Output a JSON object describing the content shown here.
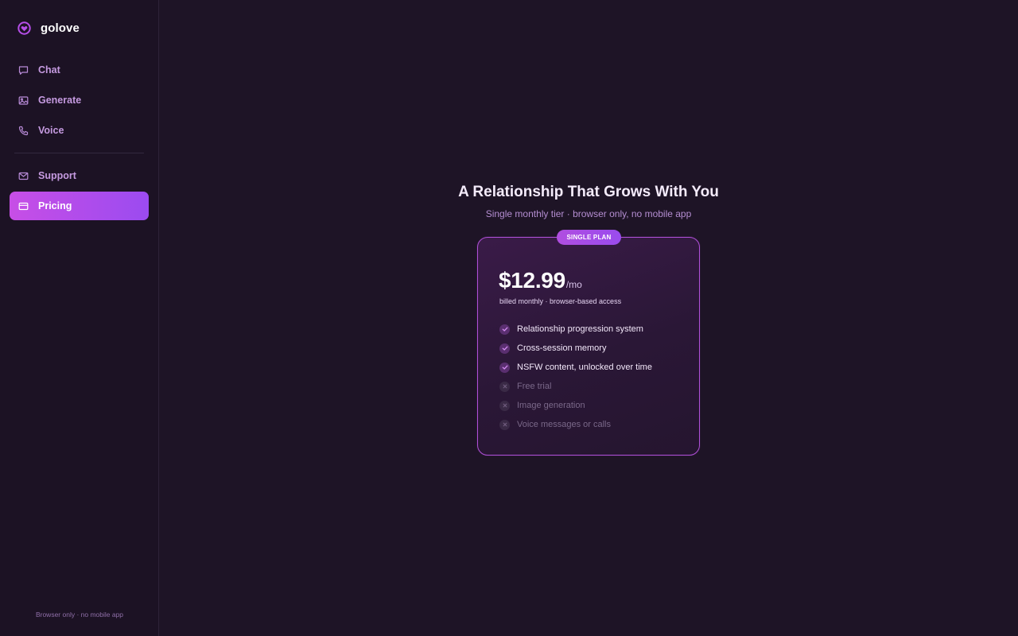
{
  "app": {
    "name": "golove"
  },
  "sidebar": {
    "items": [
      {
        "label": "Chat",
        "icon": "chat-bubble-icon"
      },
      {
        "label": "Generate",
        "icon": "image-icon"
      },
      {
        "label": "Voice",
        "icon": "phone-icon"
      }
    ],
    "secondary": [
      {
        "label": "Support",
        "icon": "mail-icon"
      },
      {
        "label": "Pricing",
        "icon": "credit-card-icon",
        "active": true
      }
    ],
    "footer": "Browser only · no mobile app"
  },
  "main": {
    "title": "A Relationship That Grows With You",
    "subtitle": "Single monthly tier · browser only, no mobile app",
    "plan": {
      "badge": "SINGLE PLAN",
      "price": "$12.99",
      "unit": "/mo",
      "billing": "billed monthly · browser-based access",
      "features": [
        {
          "text": "Relationship progression system",
          "included": true
        },
        {
          "text": "Cross-session memory",
          "included": true
        },
        {
          "text": "NSFW content, unlocked over time",
          "included": true
        },
        {
          "text": "Free trial",
          "included": false
        },
        {
          "text": "Image generation",
          "included": false
        },
        {
          "text": "Voice messages or calls",
          "included": false
        }
      ]
    }
  },
  "colors": {
    "background": "#1e1426",
    "accent_start": "#c74ee6",
    "accent_end": "#9b4bf0",
    "card_border": "#b050d8"
  }
}
